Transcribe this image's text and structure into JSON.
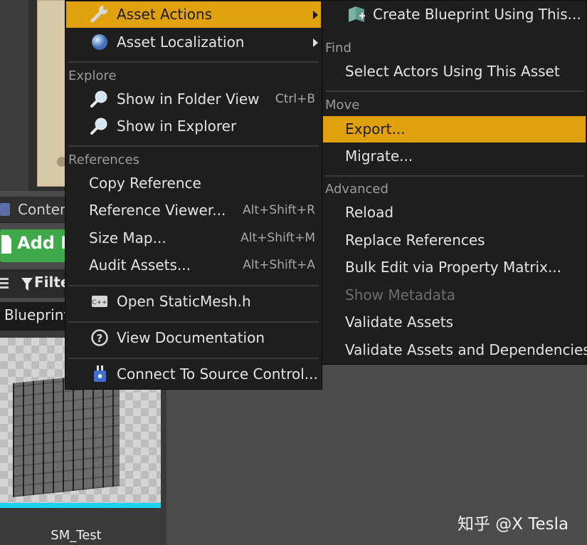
{
  "background": {
    "content_tab_label": "Conten",
    "add_new_label": "Add N",
    "filter_label": "Filte",
    "blueprint_label": "Blueprint",
    "thumbnail_label": "SM_Test"
  },
  "main_menu": {
    "items": [
      {
        "label": "Asset Actions",
        "icon": "wrench-icon",
        "submenu": true,
        "highlight": true
      },
      {
        "label": "Asset Localization",
        "icon": "globe-icon",
        "submenu": true
      }
    ],
    "explore": {
      "header": "Explore",
      "items": [
        {
          "label": "Show in Folder View",
          "shortcut": "Ctrl+B",
          "icon": "magnifier-icon"
        },
        {
          "label": "Show in Explorer",
          "shortcut": "",
          "icon": "magnifier-icon"
        }
      ]
    },
    "references": {
      "header": "References",
      "items": [
        {
          "label": "Copy Reference",
          "shortcut": ""
        },
        {
          "label": "Reference Viewer...",
          "shortcut": "Alt+Shift+R"
        },
        {
          "label": "Size Map...",
          "shortcut": "Alt+Shift+M"
        },
        {
          "label": "Audit Assets...",
          "shortcut": "Alt+Shift+A"
        }
      ]
    },
    "open_source": {
      "label": "Open StaticMesh.h",
      "icon": "cpp-file-icon"
    },
    "documentation": {
      "label": "View Documentation",
      "icon": "help-icon"
    },
    "source_control": {
      "label": "Connect To Source Control...",
      "icon": "source-control-icon"
    }
  },
  "sub_menu": {
    "create_blueprint": {
      "label": "Create Blueprint Using This...",
      "icon": "blueprint-icon"
    },
    "find": {
      "header": "Find",
      "items": [
        {
          "label": "Select Actors Using This Asset"
        }
      ]
    },
    "move": {
      "header": "Move",
      "items": [
        {
          "label": "Export...",
          "highlight": true
        },
        {
          "label": "Migrate..."
        }
      ]
    },
    "advanced": {
      "header": "Advanced",
      "items": [
        {
          "label": "Reload"
        },
        {
          "label": "Replace References"
        },
        {
          "label": "Bulk Edit via Property Matrix..."
        },
        {
          "label": "Show Metadata",
          "disabled": true
        },
        {
          "label": "Validate Assets"
        },
        {
          "label": "Validate Assets and Dependencies"
        }
      ]
    }
  },
  "watermark": "知乎 @X Tesla",
  "colors": {
    "highlight": "#e0a10c",
    "menu_bg": "#1e1e1e",
    "add_new_green": "#3fa84a",
    "selection_cyan": "#1ed3f0"
  }
}
